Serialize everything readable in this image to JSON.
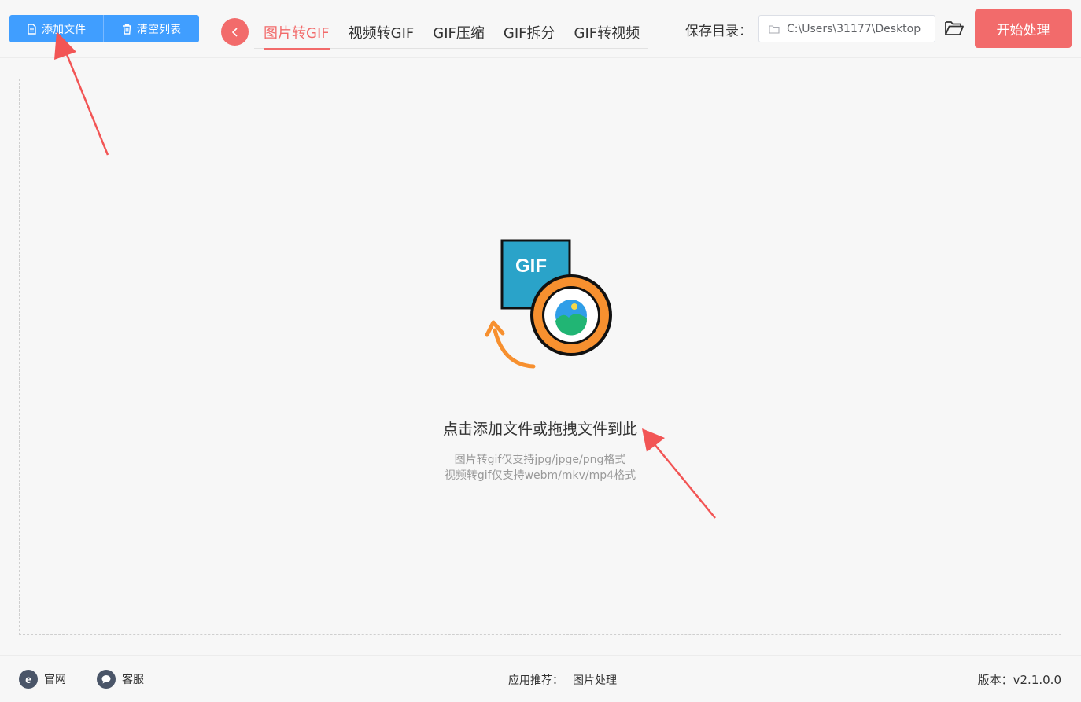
{
  "toolbar": {
    "add_file_label": "添加文件",
    "clear_list_label": "清空列表"
  },
  "tabs": [
    {
      "label": "图片转GIF",
      "active": true
    },
    {
      "label": "视频转GIF",
      "active": false
    },
    {
      "label": "GIF压缩",
      "active": false
    },
    {
      "label": "GIF拆分",
      "active": false
    },
    {
      "label": "GIF转视频",
      "active": false
    }
  ],
  "save": {
    "label": "保存目录：",
    "path": "C:\\Users\\31177\\Desktop"
  },
  "start_label": "开始处理",
  "dropzone": {
    "illustration_text": "GIF",
    "main_text": "点击添加文件或拖拽文件到此",
    "hint_line1": "图片转gif仅支持jpg/jpge/png格式",
    "hint_line2": "视频转gif仅支持webm/mkv/mp4格式"
  },
  "footer": {
    "website_label": "官网",
    "service_label": "客服",
    "recommend_label": "应用推荐：",
    "recommend_link": "图片处理",
    "version": "版本：v2.1.0.0"
  },
  "colors": {
    "primary_blue": "#409eff",
    "accent_red": "#f26b6b",
    "gif_blue": "#2aa3c9",
    "ring_orange": "#f7902f"
  },
  "icons": [
    "file-icon",
    "trash-icon",
    "chevron-left-icon",
    "folder-small-icon",
    "open-folder-icon",
    "ie-icon",
    "chat-icon",
    "annotation-arrow"
  ]
}
